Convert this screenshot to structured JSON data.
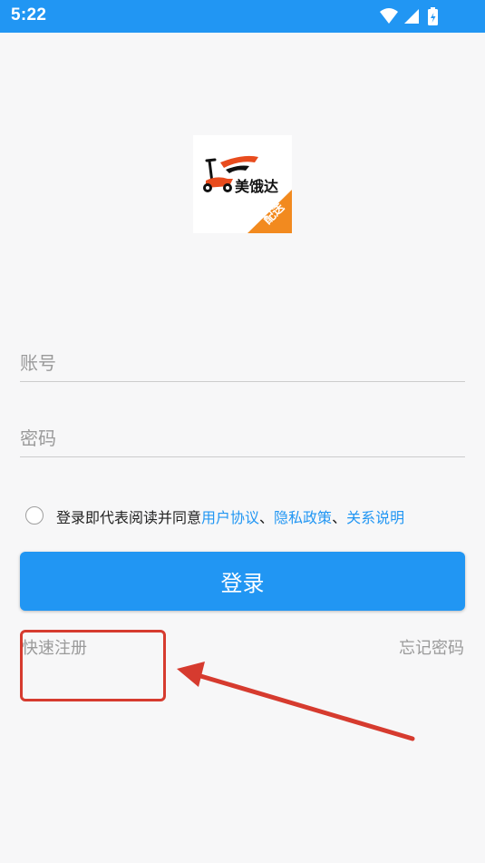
{
  "status_bar": {
    "time": "5:22",
    "icons": [
      "wifi-icon",
      "signal-icon",
      "battery-icon"
    ]
  },
  "logo": {
    "brand_text": "美饿达",
    "badge_text": "配送"
  },
  "form": {
    "account_placeholder": "账号",
    "password_placeholder": "密码"
  },
  "agreement": {
    "prefix": "登录即代表阅读并同意",
    "user_agreement": "用户协议",
    "sep1": "、",
    "privacy_policy": "隐私政策",
    "sep2": "、",
    "relation_note": "关系说明"
  },
  "actions": {
    "login_label": "登录",
    "quick_register_label": "快速注册",
    "forgot_password_label": "忘记密码"
  },
  "colors": {
    "accent": "#2196f3",
    "annotation": "#d63b2f",
    "brand_orange": "#f28a1f"
  }
}
